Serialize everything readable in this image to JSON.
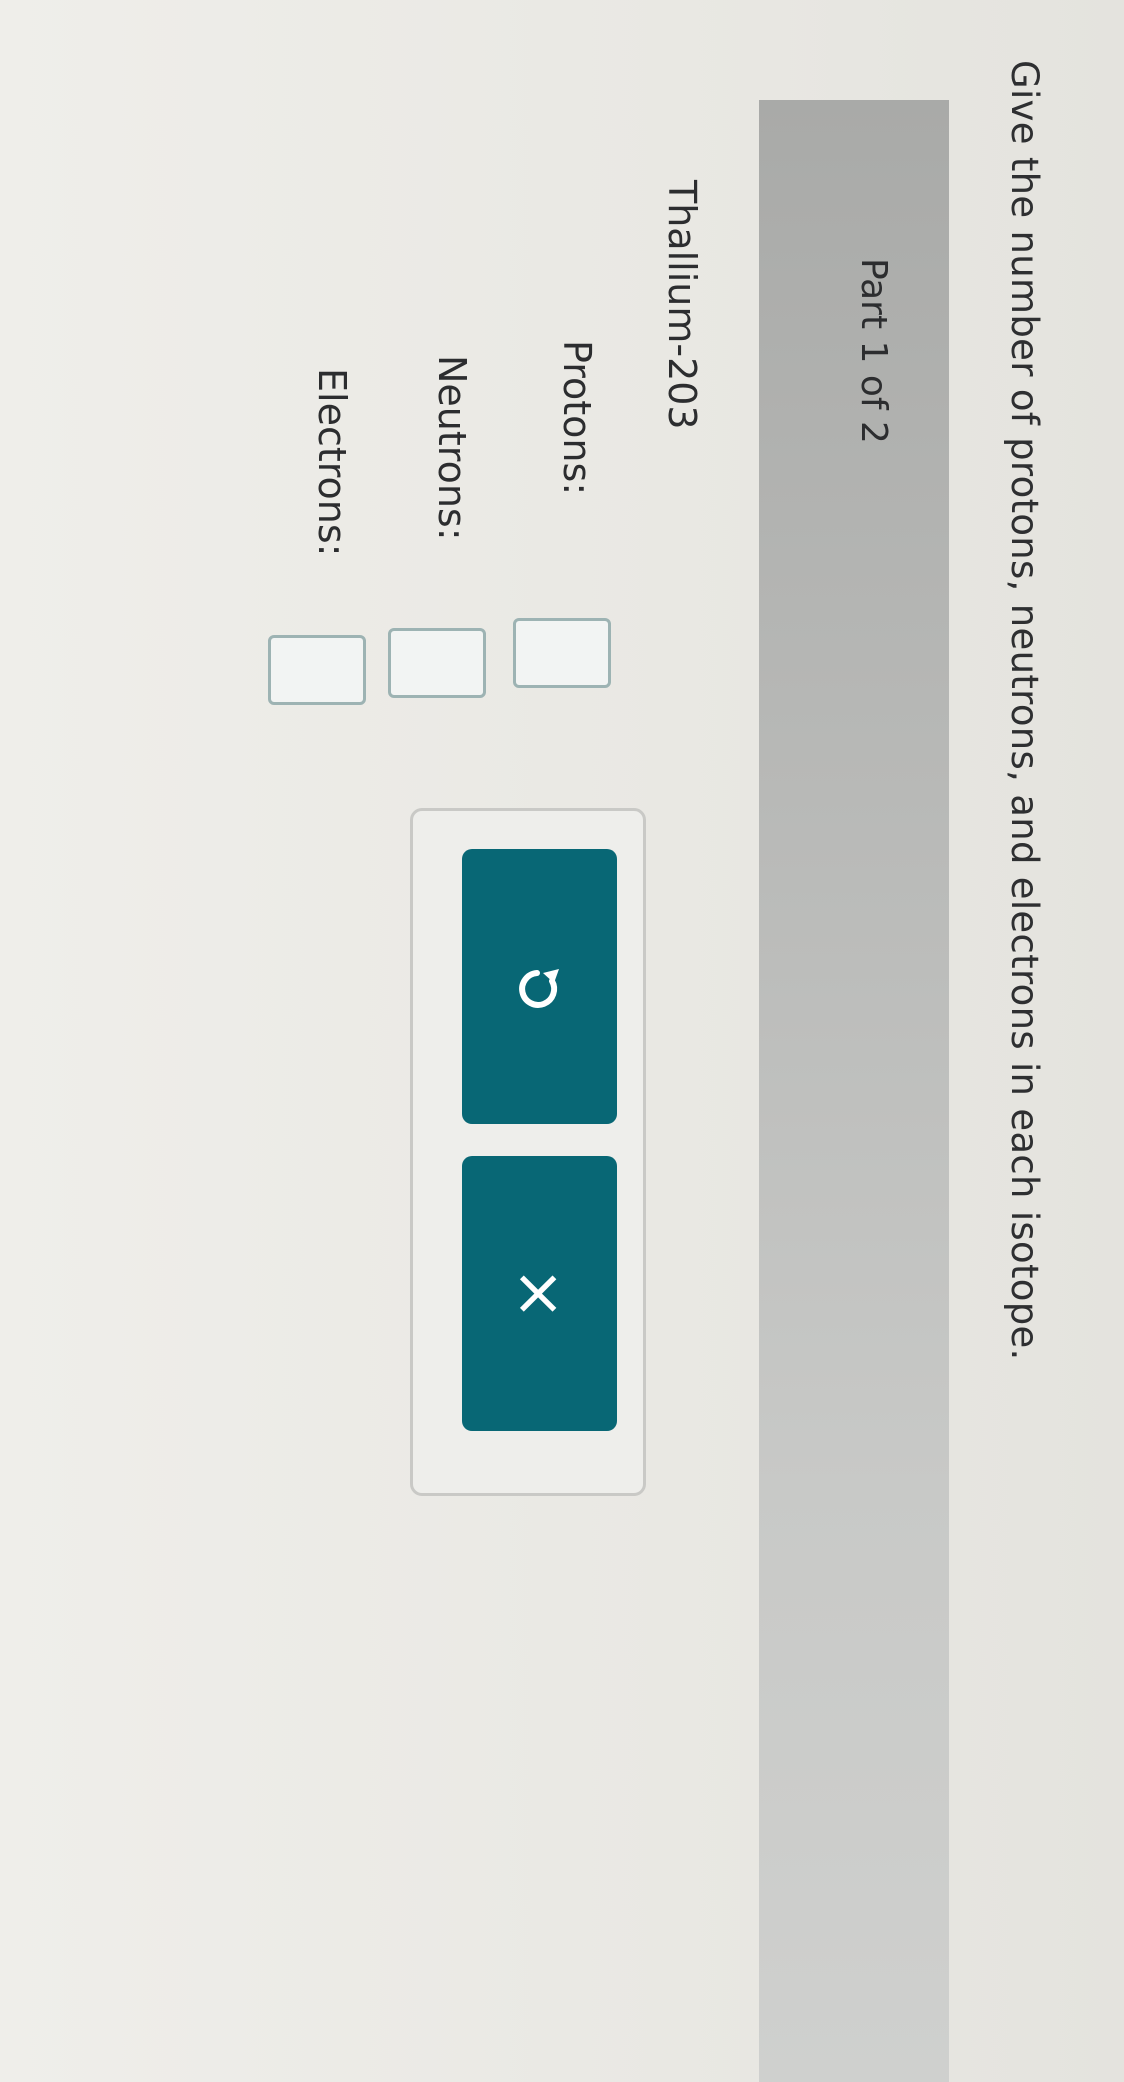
{
  "question": {
    "instruction": "Give the number of protons, neutrons, and electrons in each isotope."
  },
  "part": {
    "label": "Part 1 of 2"
  },
  "isotope": {
    "name": "Thallium-203",
    "fields": [
      {
        "label": "Protons:",
        "value": ""
      },
      {
        "label": "Neutrons:",
        "value": ""
      },
      {
        "label": "Electrons:",
        "value": ""
      }
    ]
  },
  "toolbar": {
    "undo_icon": "undo-icon",
    "clear_icon": "close-icon",
    "clear_glyph": "×"
  },
  "colors": {
    "button": "#086775",
    "input_border": "#9db3b3"
  }
}
